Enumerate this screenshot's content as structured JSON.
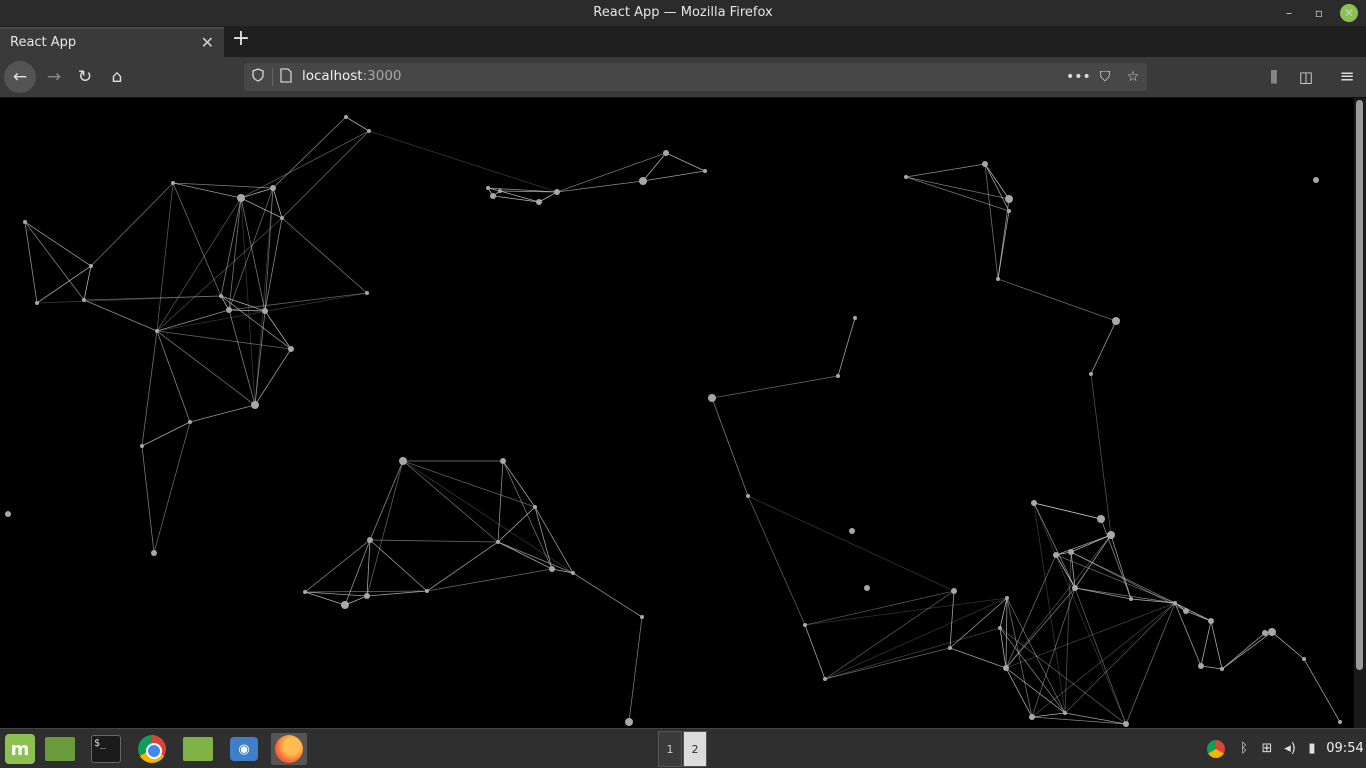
{
  "window": {
    "title": "React App — Mozilla Firefox",
    "minimize": "–",
    "maximize": "▫",
    "close": "✕"
  },
  "tabs": [
    {
      "label": "React App",
      "close": "✕"
    }
  ],
  "new_tab": "+",
  "nav": {
    "back": "←",
    "forward": "→",
    "reload": "↻",
    "home": "⌂"
  },
  "url": {
    "host": "localhost",
    "port": ":3000",
    "more": "•••",
    "pocket": "⛉",
    "star": "☆"
  },
  "toolbar": {
    "library": "⫼",
    "sidebar": "◫",
    "menu": "≡"
  },
  "taskbar": {
    "terminal": "$_",
    "screenshot": "◉",
    "workspaces": [
      "1",
      "2"
    ],
    "tray": {
      "bluetooth": "ᛒ",
      "network": "⊞",
      "volume": "◂)",
      "battery": "▮"
    },
    "clock": "09:54"
  },
  "network": {
    "nodes": [
      [
        346,
        117,
        2
      ],
      [
        369,
        131,
        2
      ],
      [
        173,
        183,
        2
      ],
      [
        241,
        198,
        4
      ],
      [
        273,
        188,
        3
      ],
      [
        282,
        218,
        2
      ],
      [
        25,
        222,
        2
      ],
      [
        91,
        266,
        2
      ],
      [
        37,
        303,
        2
      ],
      [
        84,
        300,
        2
      ],
      [
        221,
        296,
        2
      ],
      [
        229,
        310,
        3
      ],
      [
        265,
        311,
        3
      ],
      [
        367,
        293,
        2
      ],
      [
        157,
        331,
        2
      ],
      [
        291,
        349,
        3
      ],
      [
        255,
        405,
        4
      ],
      [
        190,
        422,
        2
      ],
      [
        142,
        446,
        2
      ],
      [
        154,
        553,
        3
      ],
      [
        8,
        514,
        3
      ],
      [
        488,
        188,
        2
      ],
      [
        493,
        196,
        3
      ],
      [
        500,
        191,
        2
      ],
      [
        539,
        202,
        3
      ],
      [
        557,
        192,
        3
      ],
      [
        643,
        181,
        4
      ],
      [
        666,
        153,
        3
      ],
      [
        705,
        171,
        2
      ],
      [
        906,
        177,
        2
      ],
      [
        985,
        164,
        3
      ],
      [
        1009,
        199,
        4
      ],
      [
        1009,
        211,
        2
      ],
      [
        998,
        279,
        2
      ],
      [
        1116,
        321,
        4
      ],
      [
        1091,
        374,
        2
      ],
      [
        1316,
        180,
        3
      ],
      [
        855,
        318,
        2
      ],
      [
        838,
        376,
        2
      ],
      [
        712,
        398,
        4
      ],
      [
        748,
        496,
        2
      ],
      [
        403,
        461,
        4
      ],
      [
        503,
        461,
        3
      ],
      [
        535,
        507,
        2
      ],
      [
        498,
        542,
        2
      ],
      [
        370,
        540,
        3
      ],
      [
        552,
        569,
        3
      ],
      [
        573,
        573,
        2
      ],
      [
        305,
        592,
        2
      ],
      [
        367,
        596,
        3
      ],
      [
        345,
        605,
        4
      ],
      [
        427,
        591,
        2
      ],
      [
        642,
        617,
        2
      ],
      [
        629,
        722,
        4
      ],
      [
        852,
        531,
        3
      ],
      [
        867,
        588,
        3
      ],
      [
        805,
        625,
        2
      ],
      [
        825,
        679,
        2
      ],
      [
        954,
        591,
        3
      ],
      [
        950,
        648,
        2
      ],
      [
        1007,
        598,
        2
      ],
      [
        1000,
        628,
        2
      ],
      [
        1006,
        668,
        3
      ],
      [
        1032,
        717,
        3
      ],
      [
        1065,
        713,
        2
      ],
      [
        1126,
        724,
        3
      ],
      [
        1034,
        503,
        3
      ],
      [
        1101,
        519,
        4
      ],
      [
        1111,
        535,
        4
      ],
      [
        1056,
        555,
        3
      ],
      [
        1071,
        552,
        3
      ],
      [
        1075,
        588,
        3
      ],
      [
        1131,
        599,
        2
      ],
      [
        1175,
        603,
        2
      ],
      [
        1186,
        611,
        3
      ],
      [
        1211,
        621,
        3
      ],
      [
        1201,
        666,
        3
      ],
      [
        1222,
        669,
        2
      ],
      [
        1265,
        633,
        3
      ],
      [
        1272,
        632,
        4
      ],
      [
        1304,
        659,
        2
      ],
      [
        1340,
        722,
        2
      ]
    ],
    "edges": [
      [
        0,
        1
      ],
      [
        0,
        4
      ],
      [
        1,
        3
      ],
      [
        1,
        5
      ],
      [
        1,
        25
      ],
      [
        2,
        3
      ],
      [
        2,
        4
      ],
      [
        2,
        7
      ],
      [
        2,
        10
      ],
      [
        3,
        4
      ],
      [
        3,
        5
      ],
      [
        3,
        10
      ],
      [
        3,
        11
      ],
      [
        3,
        12
      ],
      [
        3,
        14
      ],
      [
        4,
        5
      ],
      [
        4,
        11
      ],
      [
        4,
        12
      ],
      [
        5,
        12
      ],
      [
        5,
        13
      ],
      [
        5,
        14
      ],
      [
        6,
        7
      ],
      [
        6,
        8
      ],
      [
        6,
        9
      ],
      [
        7,
        8
      ],
      [
        7,
        9
      ],
      [
        8,
        10
      ],
      [
        9,
        10
      ],
      [
        9,
        14
      ],
      [
        10,
        11
      ],
      [
        10,
        12
      ],
      [
        10,
        15
      ],
      [
        11,
        12
      ],
      [
        11,
        14
      ],
      [
        11,
        16
      ],
      [
        12,
        15
      ],
      [
        12,
        16
      ],
      [
        13,
        14
      ],
      [
        13,
        11
      ],
      [
        14,
        15
      ],
      [
        14,
        16
      ],
      [
        14,
        17
      ],
      [
        14,
        18
      ],
      [
        15,
        16
      ],
      [
        16,
        17
      ],
      [
        17,
        18
      ],
      [
        18,
        19
      ],
      [
        19,
        17
      ],
      [
        3,
        16
      ],
      [
        4,
        16
      ],
      [
        2,
        14
      ],
      [
        21,
        22
      ],
      [
        21,
        23
      ],
      [
        22,
        23
      ],
      [
        22,
        24
      ],
      [
        23,
        24
      ],
      [
        23,
        25
      ],
      [
        24,
        25
      ],
      [
        25,
        26
      ],
      [
        25,
        27
      ],
      [
        26,
        27
      ],
      [
        27,
        28
      ],
      [
        26,
        28
      ],
      [
        21,
        25
      ],
      [
        29,
        30
      ],
      [
        29,
        31
      ],
      [
        29,
        32
      ],
      [
        30,
        31
      ],
      [
        30,
        32
      ],
      [
        31,
        33
      ],
      [
        32,
        33
      ],
      [
        30,
        33
      ],
      [
        33,
        34
      ],
      [
        34,
        35
      ],
      [
        35,
        68
      ],
      [
        37,
        38
      ],
      [
        38,
        39
      ],
      [
        39,
        40
      ],
      [
        40,
        56
      ],
      [
        40,
        58
      ],
      [
        41,
        42
      ],
      [
        41,
        43
      ],
      [
        41,
        44
      ],
      [
        41,
        45
      ],
      [
        41,
        49
      ],
      [
        41,
        47
      ],
      [
        42,
        43
      ],
      [
        42,
        44
      ],
      [
        42,
        46
      ],
      [
        43,
        44
      ],
      [
        43,
        46
      ],
      [
        43,
        47
      ],
      [
        44,
        45
      ],
      [
        44,
        46
      ],
      [
        44,
        47
      ],
      [
        44,
        51
      ],
      [
        45,
        48
      ],
      [
        45,
        49
      ],
      [
        45,
        50
      ],
      [
        45,
        51
      ],
      [
        46,
        47
      ],
      [
        46,
        51
      ],
      [
        47,
        52
      ],
      [
        48,
        49
      ],
      [
        48,
        50
      ],
      [
        48,
        51
      ],
      [
        49,
        50
      ],
      [
        49,
        51
      ],
      [
        52,
        53
      ],
      [
        56,
        57
      ],
      [
        56,
        58
      ],
      [
        56,
        60
      ],
      [
        57,
        58
      ],
      [
        57,
        59
      ],
      [
        57,
        60
      ],
      [
        57,
        61
      ],
      [
        58,
        59
      ],
      [
        59,
        60
      ],
      [
        60,
        61
      ],
      [
        60,
        62
      ],
      [
        60,
        63
      ],
      [
        60,
        64
      ],
      [
        61,
        62
      ],
      [
        61,
        64
      ],
      [
        61,
        65
      ],
      [
        62,
        63
      ],
      [
        62,
        64
      ],
      [
        63,
        64
      ],
      [
        63,
        65
      ],
      [
        64,
        66
      ],
      [
        64,
        65
      ],
      [
        65,
        66
      ],
      [
        66,
        67
      ],
      [
        62,
        68
      ],
      [
        62,
        69
      ],
      [
        62,
        71
      ],
      [
        63,
        71
      ],
      [
        68,
        69
      ],
      [
        68,
        70
      ],
      [
        68,
        71
      ],
      [
        68,
        72
      ],
      [
        69,
        70
      ],
      [
        69,
        71
      ],
      [
        69,
        73
      ],
      [
        70,
        71
      ],
      [
        70,
        73
      ],
      [
        70,
        74
      ],
      [
        71,
        72
      ],
      [
        71,
        73
      ],
      [
        72,
        73
      ],
      [
        73,
        74
      ],
      [
        73,
        75
      ],
      [
        73,
        76
      ],
      [
        74,
        75
      ],
      [
        75,
        76
      ],
      [
        75,
        77
      ],
      [
        76,
        77
      ],
      [
        77,
        78
      ],
      [
        77,
        79
      ],
      [
        78,
        79
      ],
      [
        79,
        80
      ],
      [
        79,
        82
      ],
      [
        80,
        81
      ],
      [
        80,
        82
      ],
      [
        81,
        82
      ],
      [
        83,
        82
      ],
      [
        83,
        84
      ],
      [
        81,
        84
      ],
      [
        66,
        83
      ],
      [
        67,
        66
      ],
      [
        65,
        73
      ],
      [
        64,
        73
      ],
      [
        63,
        73
      ],
      [
        62,
        73
      ],
      [
        64,
        70
      ],
      [
        65,
        71
      ],
      [
        66,
        71
      ],
      [
        67,
        72
      ],
      [
        59,
        62
      ]
    ]
  }
}
